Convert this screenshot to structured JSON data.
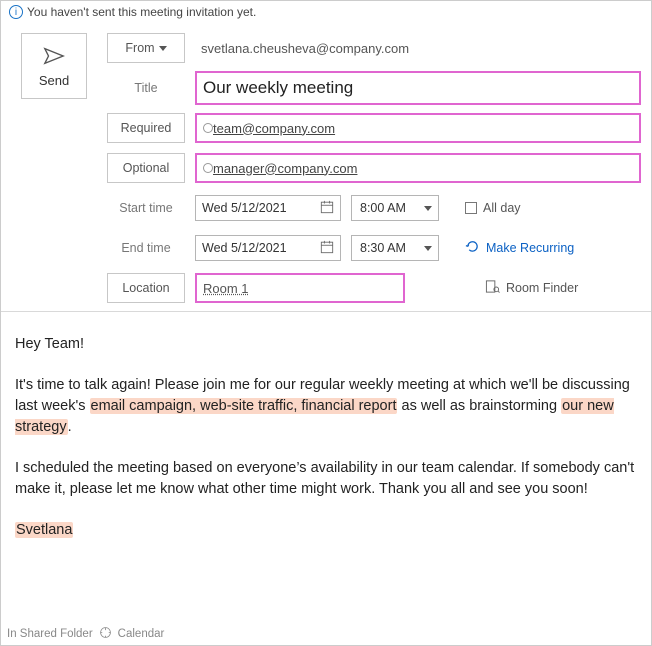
{
  "info_bar": "You haven't sent this meeting invitation yet.",
  "send_label": "Send",
  "fields": {
    "from_label": "From",
    "from_value": "svetlana.cheusheva@company.com",
    "title_label": "Title",
    "title_value": "Our weekly meeting",
    "required_label": "Required",
    "required_value": "team@company.com",
    "optional_label": "Optional",
    "optional_value": "manager@company.com",
    "start_label": "Start time",
    "start_date": "Wed 5/12/2021",
    "start_time": "8:00 AM",
    "end_label": "End time",
    "end_date": "Wed 5/12/2021",
    "end_time": "8:30 AM",
    "allday_label": "All day",
    "recurring_label": "Make Recurring",
    "location_label": "Location",
    "location_value": "Room 1",
    "roomfinder_label": "Room Finder"
  },
  "body": {
    "greeting": "Hey Team!",
    "p1a": "It's time to talk again! Please join me for our regular weekly meeting at which we'll be discussing last week's ",
    "hl1": "email campaign, web-site traffic, financial report",
    "p1b": " as well as brainstorming ",
    "hl2": "our new strategy",
    "p1c": ".",
    "p2": "I scheduled the meeting based on everyone’s availability in our team calendar. If somebody can't make it, please let me know what other time might work. Thank you all and see you soon!",
    "sig": "Svetlana"
  },
  "footer": {
    "folder": "In Shared Folder",
    "calendar": "Calendar"
  }
}
